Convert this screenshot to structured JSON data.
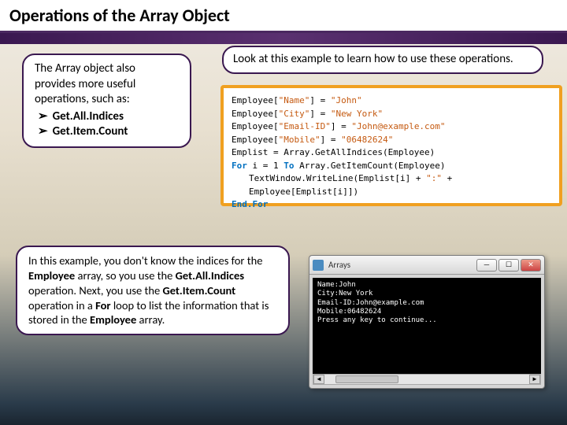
{
  "header": {
    "title": "Operations of the Array Object"
  },
  "box_left_top": {
    "intro": "The Array object also provides more useful operations, such as:",
    "items": [
      "Get.All.Indices",
      "Get.Item.Count"
    ]
  },
  "box_right_top": {
    "text": "Look at this example to learn how to use these operations."
  },
  "code": {
    "l1a": "Employee[",
    "l1b": "\"Name\"",
    "l1c": "] = ",
    "l1d": "\"John\"",
    "l2a": "Employee[",
    "l2b": "\"City\"",
    "l2c": "] = ",
    "l2d": "\"New York\"",
    "l3a": "Employee[",
    "l3b": "\"Email-ID\"",
    "l3c": "] = ",
    "l3d": "\"John@example.com\"",
    "l4a": "Employee[",
    "l4b": "\"Mobile\"",
    "l4c": "] = ",
    "l4d": "\"06482624\"",
    "l5": "Emplist = Array.GetAllIndices(Employee)",
    "l6a": "For",
    "l6b": " i = 1 ",
    "l6c": "To",
    "l6d": " Array.GetItemCount(Employee)",
    "l7a": "TextWindow.WriteLine(Emplist[i] + ",
    "l7b": "\":\"",
    "l7c": " + Employee[Emplist[i]])",
    "l8": "End.For"
  },
  "box_left_bottom": {
    "text_parts": {
      "p1": "In this example, you don't know the indices for the ",
      "b1": "Employee",
      "p2": " array, so you use the ",
      "b2": "Get.All.Indices",
      "p3": " operation. Next, you use the ",
      "b3": "Get.Item.Count",
      "p4": " operation in a ",
      "b4": "For",
      "p5": " loop to list the information that is stored in the ",
      "b5": "Employee",
      "p6": " array."
    }
  },
  "window": {
    "title": "Arrays",
    "console_lines": "Name:John\nCity:New York\nEmail-ID:John@example.com\nMobile:06482624\nPress any key to continue..."
  }
}
